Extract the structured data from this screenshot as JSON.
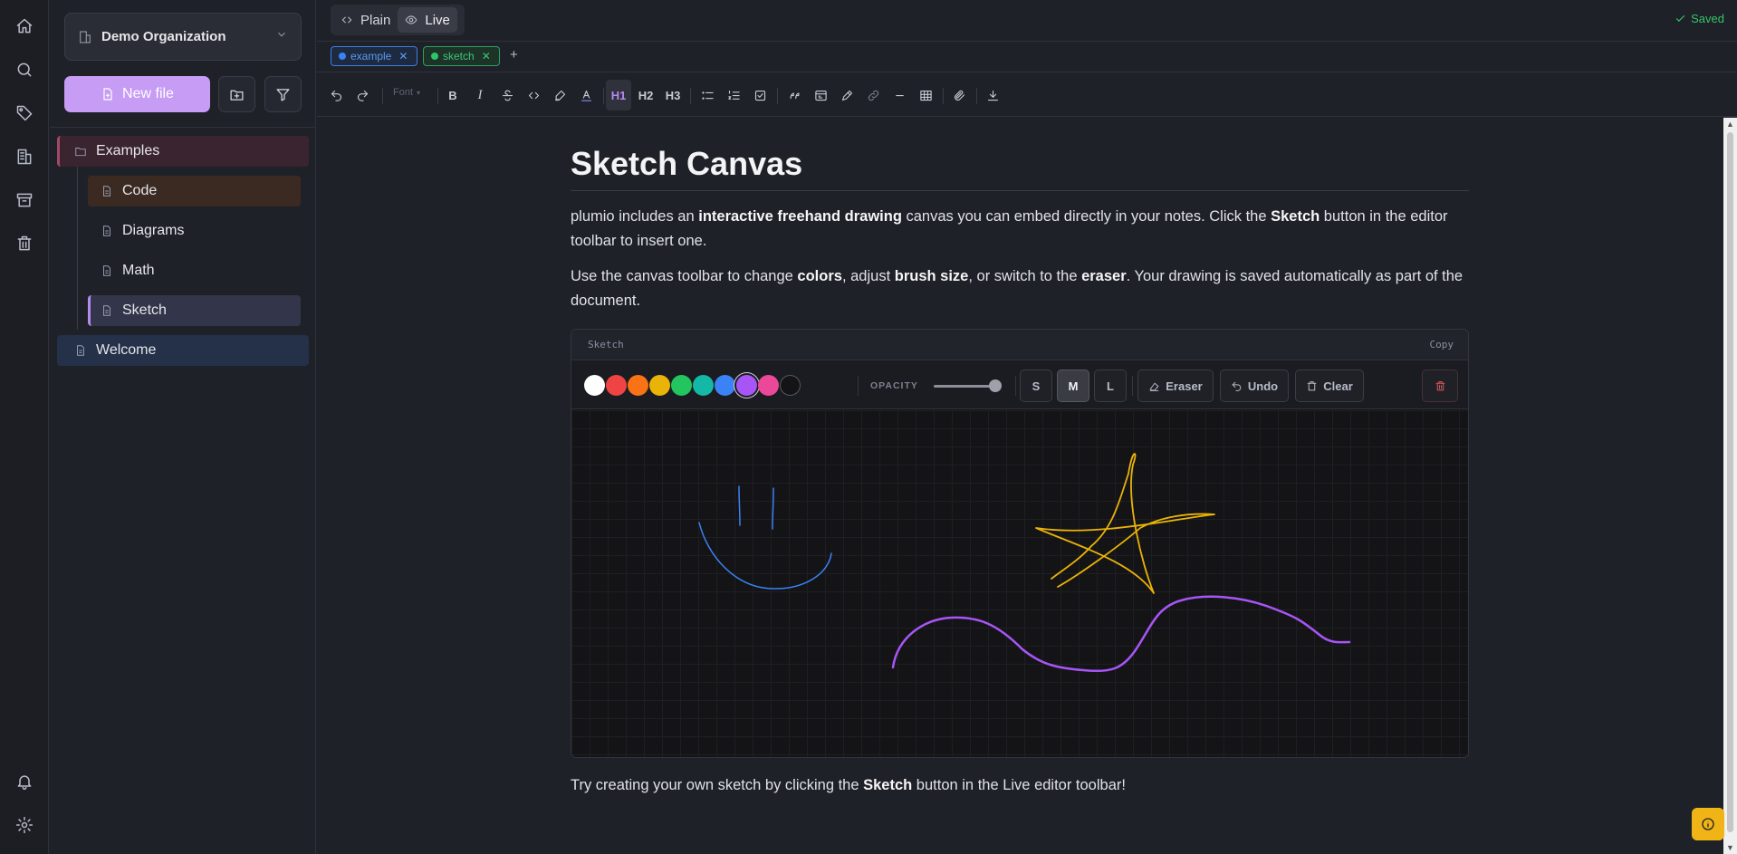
{
  "sidebar": {
    "org_name": "Demo Organization",
    "new_file_label": "New file",
    "tree": {
      "examples": "Examples",
      "code": "Code",
      "diagrams": "Diagrams",
      "math": "Math",
      "sketch": "Sketch",
      "welcome": "Welcome"
    }
  },
  "header": {
    "mode_plain": "Plain",
    "mode_live": "Live",
    "status": "Saved"
  },
  "tags": [
    {
      "label": "example",
      "color": "#3b82f6"
    },
    {
      "label": "sketch",
      "color": "#2ec46a"
    }
  ],
  "tag_add": "+",
  "toolbar": {
    "font_label": "Font",
    "h1": "H1",
    "h2": "H2",
    "h3": "H3",
    "bold": "B",
    "italic": "I"
  },
  "document": {
    "title": "Sketch Canvas",
    "p1_parts": [
      "plumio includes an ",
      "interactive freehand drawing",
      " canvas you can embed directly in your notes. Click the ",
      "Sketch",
      " button in the editor toolbar to insert one."
    ],
    "p2_parts": [
      "Use the canvas toolbar to change ",
      "colors",
      ", adjust ",
      "brush size",
      ", or switch to the ",
      "eraser",
      ". Your drawing is saved automatically as part of the document."
    ],
    "p3_parts": [
      "Try creating your own sketch by clicking the ",
      "Sketch",
      " button in the Live editor toolbar!"
    ]
  },
  "sketch": {
    "label": "Sketch",
    "copy": "Copy",
    "opacity_label": "OPACITY",
    "opacity_value": 1.0,
    "colors": [
      "#ffffff",
      "#ef4444",
      "#f97316",
      "#eab308",
      "#22c55e",
      "#14b8a6",
      "#3b82f6",
      "#a855f7",
      "#ec4899",
      "#141416"
    ],
    "selected_color": "#a855f7",
    "sizes": [
      "S",
      "M",
      "L"
    ],
    "selected_size": "M",
    "eraser": "Eraser",
    "undo": "Undo",
    "clear": "Clear"
  },
  "stroke_colors": {
    "face": "#3b82f6",
    "star": "#eab308",
    "wave": "#a855f7"
  }
}
